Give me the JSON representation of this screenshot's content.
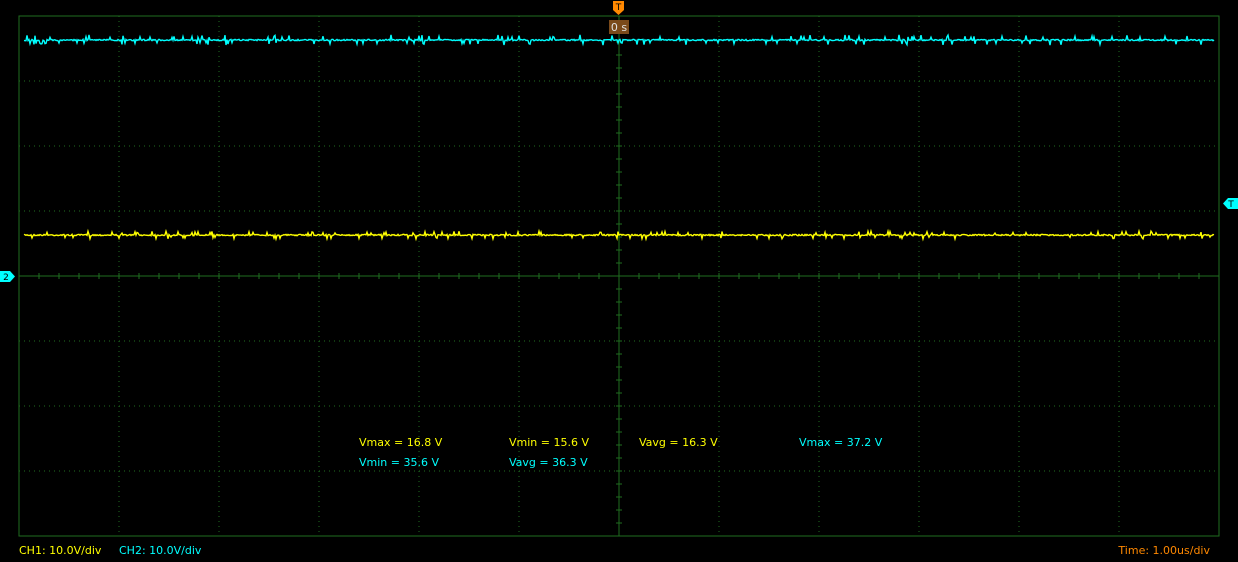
{
  "colors": {
    "background": "#000000",
    "grid": "#1f6e1f",
    "ch1": "#ffff00",
    "ch2": "#00ffff",
    "trigger": "#ff8800"
  },
  "trigger": {
    "marker_label": "T",
    "time_label": "0 s",
    "level_marker_label": "T"
  },
  "ch2_ground_marker": "2",
  "measurements": {
    "ch1_vmax": "Vmax = 16.8 V",
    "ch1_vmin": "Vmin = 15.6 V",
    "ch1_vavg": "Vavg = 16.3 V",
    "ch2_vmax": "Vmax = 37.2 V",
    "ch2_vmin": "Vmin = 35.6 V",
    "ch2_vavg": "Vavg = 36.3 V"
  },
  "footer": {
    "ch1_scale": "CH1: 10.0V/div",
    "ch2_scale": "CH2: 10.0V/div",
    "timebase": "Time: 1.00us/div"
  },
  "chart_data": {
    "type": "line",
    "title": "",
    "xlabel": "",
    "ylabel": "",
    "x_divisions": 12,
    "y_divisions": 8,
    "time_per_div_us": 1.0,
    "xlim_us": [
      -6,
      6
    ],
    "grid": true,
    "series": [
      {
        "name": "CH1",
        "color": "#ffff00",
        "volts_per_div": 10.0,
        "ground_div_from_center": -1.0,
        "level_v": 16.3,
        "vmax": 16.8,
        "vmin": 15.6,
        "vavg": 16.3
      },
      {
        "name": "CH2",
        "color": "#00ffff",
        "volts_per_div": 10.0,
        "ground_div_from_center": 0.0,
        "level_v": 36.3,
        "vmax": 37.2,
        "vmin": 35.6,
        "vavg": 36.3
      }
    ]
  }
}
